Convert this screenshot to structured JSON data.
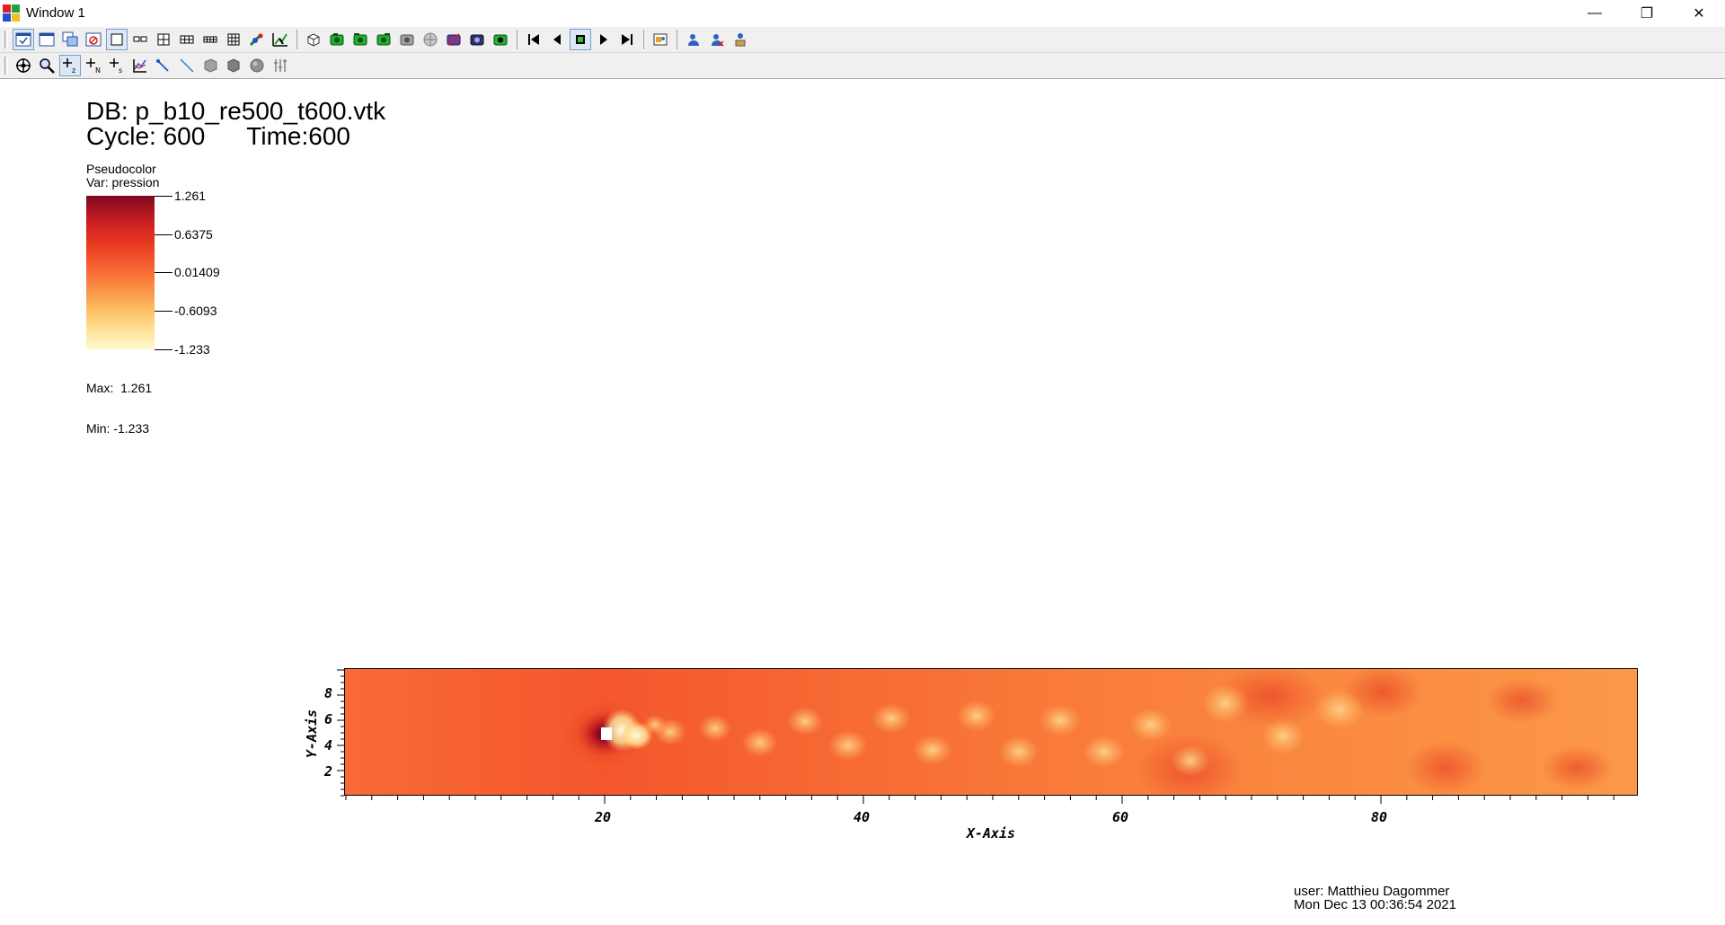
{
  "window": {
    "title": "Window 1"
  },
  "toolbar_top": {
    "icons": [
      "vis-window-icon",
      "new-window-icon",
      "clone-window-icon",
      "delete-window-icon",
      "layout-1x1-icon",
      "layout-1x2-icon",
      "layout-2x2-icon",
      "layout-2x3-icon",
      "layout-2x4-icon",
      "layout-3x3-icon",
      "lock-view-icon",
      "lock-time-icon",
      "toggle-spin-icon",
      "save-view-icon",
      "undo-view-icon",
      "redo-view-icon",
      "camera-icon",
      "choose-view-icon",
      "clear-camera-icon",
      "recenter-icon",
      "reverse-frame-icon",
      "prev-frame-icon",
      "stop-icon",
      "next-frame-icon",
      "forward-frame-icon",
      "anim-settings-icon",
      "engine-icon",
      "compute-icon",
      "hardware-icon"
    ]
  },
  "toolbar_bottom": {
    "icons": [
      "navigate-icon",
      "zoom-icon",
      "zone-pick-icon",
      "node-pick-icon",
      "spreadsheet-pick-icon",
      "lineout-icon",
      "line-icon",
      "point-tool-icon",
      "plane-tool-icon",
      "sphere-tool-icon",
      "box-tool-icon",
      "axis-tool-icon"
    ]
  },
  "viewport": {
    "db_label": "DB: p_b10_re500_t600.vtk",
    "cycle_label": "Cycle: 600",
    "time_label": "Time:600",
    "legend": {
      "plot_type": "Pseudocolor",
      "var_label": "Var: pression",
      "ticks": [
        "1.261",
        "0.6375",
        "0.01409",
        "-0.6093",
        "-1.233"
      ],
      "max_label": "Max:  1.261",
      "min_label": "Min: -1.233",
      "colors": [
        "#7f0a22",
        "#c01a22",
        "#e3321f",
        "#f4552c",
        "#fb8741",
        "#fdbd62",
        "#fee399",
        "#fffacf"
      ]
    },
    "plot": {
      "x_axis_title": "X-Axis",
      "y_axis_title": "Y-Axis",
      "x_tick_labels": [
        "20",
        "40",
        "60",
        "80"
      ],
      "y_tick_labels": [
        "2",
        "4",
        "6",
        "8"
      ]
    },
    "footer": {
      "user": "user: Matthieu Dagommer",
      "date": "Mon Dec 13 00:36:54 2021"
    }
  }
}
